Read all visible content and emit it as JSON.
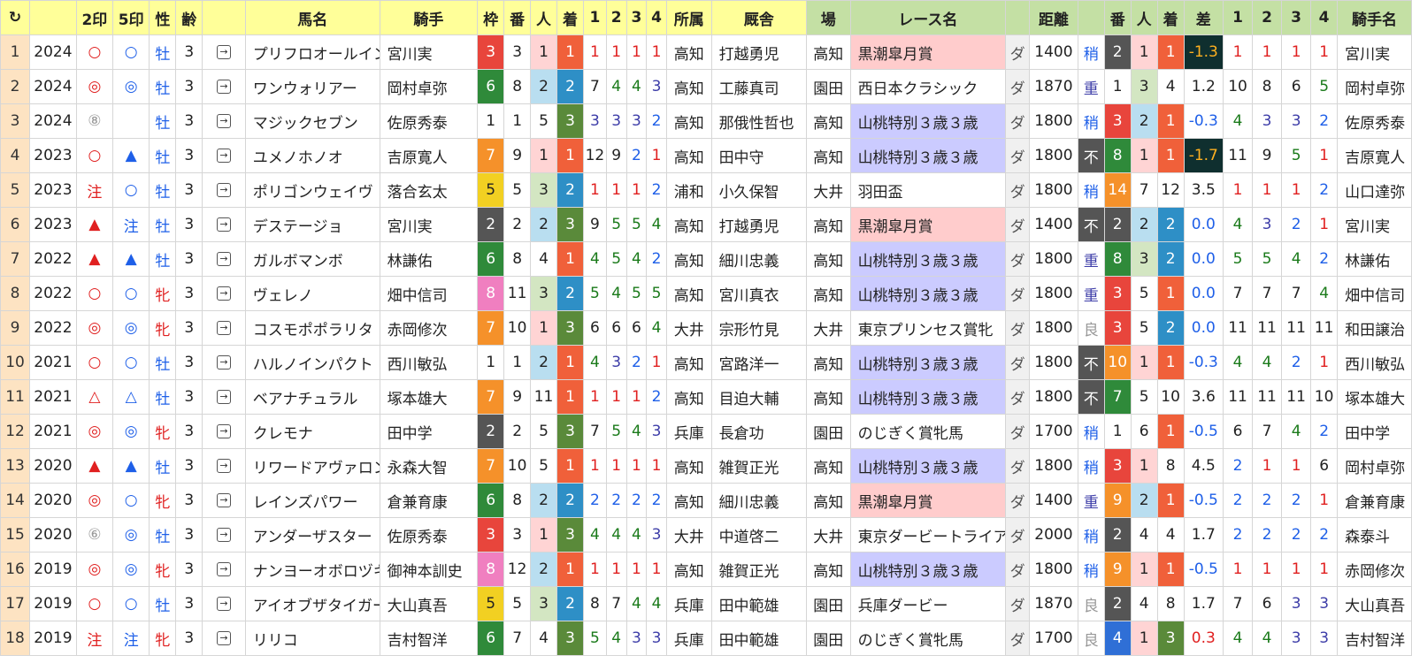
{
  "header": {
    "reload": "↻",
    "cols": [
      "",
      "2印",
      "5印",
      "性",
      "齢",
      "",
      "馬名",
      "騎手",
      "枠",
      "番",
      "人",
      "着",
      "1",
      "2",
      "3",
      "4",
      "所属",
      "厩舎",
      "場",
      "レース名",
      "",
      "距離",
      "",
      "番",
      "人",
      "着",
      "差",
      "1",
      "2",
      "3",
      "4",
      "騎手名"
    ]
  },
  "rows": [
    [
      "1",
      "2024",
      "○",
      "○",
      "牡",
      "3",
      "プリフロオールイン",
      "宮川実",
      "3",
      "3",
      "1",
      "1",
      "1",
      "1",
      "1",
      "1",
      "高知",
      "打越勇児",
      "高知",
      "黒潮皐月賞",
      "ダ",
      "1400",
      "稍",
      "2",
      "1",
      "1",
      "-1.3",
      "1",
      "1",
      "1",
      "1",
      "宮川実"
    ],
    [
      "2",
      "2024",
      "◎",
      "◎",
      "牡",
      "3",
      "ワンウォリアー",
      "岡村卓弥",
      "6",
      "8",
      "2",
      "2",
      "7",
      "4",
      "4",
      "3",
      "高知",
      "工藤真司",
      "園田",
      "西日本クラシック",
      "ダ",
      "1870",
      "重",
      "1",
      "3",
      "4",
      "1.2",
      "10",
      "8",
      "6",
      "5",
      "岡村卓弥"
    ],
    [
      "3",
      "2024",
      "⑧",
      "",
      "牡",
      "3",
      "マジックセブン",
      "佐原秀泰",
      "1",
      "1",
      "5",
      "3",
      "3",
      "3",
      "3",
      "2",
      "高知",
      "那俄性哲也",
      "高知",
      "山桃特別３歳３歳",
      "ダ",
      "1800",
      "稍",
      "3",
      "2",
      "1",
      "-0.3",
      "4",
      "3",
      "3",
      "2",
      "佐原秀泰"
    ],
    [
      "4",
      "2023",
      "○",
      "▲",
      "牡",
      "3",
      "ユメノホノオ",
      "吉原寛人",
      "7",
      "9",
      "1",
      "1",
      "12",
      "9",
      "2",
      "1",
      "高知",
      "田中守",
      "高知",
      "山桃特別３歳３歳",
      "ダ",
      "1800",
      "不",
      "8",
      "1",
      "1",
      "-1.7",
      "11",
      "9",
      "5",
      "1",
      "吉原寛人"
    ],
    [
      "5",
      "2023",
      "注",
      "○",
      "牡",
      "3",
      "ポリゴンウェイヴ",
      "落合玄太",
      "5",
      "5",
      "3",
      "2",
      "1",
      "1",
      "1",
      "2",
      "浦和",
      "小久保智",
      "大井",
      "羽田盃",
      "ダ",
      "1800",
      "稍",
      "14",
      "7",
      "12",
      "3.5",
      "1",
      "1",
      "1",
      "2",
      "山口達弥"
    ],
    [
      "6",
      "2023",
      "▲",
      "注",
      "牡",
      "3",
      "デステージョ",
      "宮川実",
      "2",
      "2",
      "2",
      "3",
      "9",
      "5",
      "5",
      "4",
      "高知",
      "打越勇児",
      "高知",
      "黒潮皐月賞",
      "ダ",
      "1400",
      "不",
      "2",
      "2",
      "2",
      "0.0",
      "4",
      "3",
      "2",
      "1",
      "宮川実"
    ],
    [
      "7",
      "2022",
      "▲",
      "▲",
      "牡",
      "3",
      "ガルボマンボ",
      "林謙佑",
      "6",
      "8",
      "4",
      "1",
      "4",
      "5",
      "4",
      "2",
      "高知",
      "細川忠義",
      "高知",
      "山桃特別３歳３歳",
      "ダ",
      "1800",
      "重",
      "8",
      "3",
      "2",
      "0.0",
      "5",
      "5",
      "4",
      "2",
      "林謙佑"
    ],
    [
      "8",
      "2022",
      "○",
      "○",
      "牝",
      "3",
      "ヴェレノ",
      "畑中信司",
      "8",
      "11",
      "3",
      "2",
      "5",
      "4",
      "5",
      "5",
      "高知",
      "宮川真衣",
      "高知",
      "山桃特別３歳３歳",
      "ダ",
      "1800",
      "重",
      "3",
      "5",
      "1",
      "0.0",
      "7",
      "7",
      "7",
      "4",
      "畑中信司"
    ],
    [
      "9",
      "2022",
      "◎",
      "◎",
      "牝",
      "3",
      "コスモポポラリタ",
      "赤岡修次",
      "7",
      "10",
      "1",
      "3",
      "6",
      "6",
      "6",
      "4",
      "大井",
      "宗形竹見",
      "大井",
      "東京プリンセス賞牝",
      "ダ",
      "1800",
      "良",
      "3",
      "5",
      "2",
      "0.0",
      "11",
      "11",
      "11",
      "11",
      "和田譲治"
    ],
    [
      "10",
      "2021",
      "○",
      "○",
      "牡",
      "3",
      "ハルノインパクト",
      "西川敏弘",
      "1",
      "1",
      "2",
      "1",
      "4",
      "3",
      "2",
      "1",
      "高知",
      "宮路洋一",
      "高知",
      "山桃特別３歳３歳",
      "ダ",
      "1800",
      "不",
      "10",
      "1",
      "1",
      "-0.3",
      "4",
      "4",
      "2",
      "1",
      "西川敏弘"
    ],
    [
      "11",
      "2021",
      "△",
      "△",
      "牡",
      "3",
      "ベアナチュラル",
      "塚本雄大",
      "7",
      "9",
      "11",
      "1",
      "1",
      "1",
      "1",
      "2",
      "高知",
      "目迫大輔",
      "高知",
      "山桃特別３歳３歳",
      "ダ",
      "1800",
      "不",
      "7",
      "5",
      "10",
      "3.6",
      "11",
      "11",
      "11",
      "10",
      "塚本雄大"
    ],
    [
      "12",
      "2021",
      "◎",
      "◎",
      "牝",
      "3",
      "クレモナ",
      "田中学",
      "2",
      "2",
      "5",
      "3",
      "7",
      "5",
      "4",
      "3",
      "兵庫",
      "長倉功",
      "園田",
      "のじぎく賞牝馬",
      "ダ",
      "1700",
      "稍",
      "1",
      "6",
      "1",
      "-0.5",
      "6",
      "7",
      "4",
      "2",
      "田中学"
    ],
    [
      "13",
      "2020",
      "▲",
      "▲",
      "牡",
      "3",
      "リワードアヴァロン",
      "永森大智",
      "7",
      "10",
      "5",
      "1",
      "1",
      "1",
      "1",
      "1",
      "高知",
      "雑賀正光",
      "高知",
      "山桃特別３歳３歳",
      "ダ",
      "1800",
      "稍",
      "3",
      "1",
      "8",
      "4.5",
      "2",
      "1",
      "1",
      "6",
      "岡村卓弥"
    ],
    [
      "14",
      "2020",
      "◎",
      "○",
      "牝",
      "3",
      "レインズパワー",
      "倉兼育康",
      "6",
      "8",
      "2",
      "2",
      "2",
      "2",
      "2",
      "2",
      "高知",
      "細川忠義",
      "高知",
      "黒潮皐月賞",
      "ダ",
      "1400",
      "重",
      "9",
      "2",
      "1",
      "-0.5",
      "2",
      "2",
      "2",
      "1",
      "倉兼育康"
    ],
    [
      "15",
      "2020",
      "⑥",
      "◎",
      "牡",
      "3",
      "アンダーザスター",
      "佐原秀泰",
      "3",
      "3",
      "1",
      "3",
      "4",
      "4",
      "4",
      "3",
      "大井",
      "中道啓二",
      "大井",
      "東京ダービートライア",
      "ダ",
      "2000",
      "稍",
      "2",
      "4",
      "4",
      "1.7",
      "2",
      "2",
      "2",
      "2",
      "森泰斗"
    ],
    [
      "16",
      "2019",
      "◎",
      "◎",
      "牝",
      "3",
      "ナンヨーオボロヅキ",
      "御神本訓史",
      "8",
      "12",
      "2",
      "1",
      "1",
      "1",
      "1",
      "1",
      "高知",
      "雑賀正光",
      "高知",
      "山桃特別３歳３歳",
      "ダ",
      "1800",
      "稍",
      "9",
      "1",
      "1",
      "-0.5",
      "1",
      "1",
      "1",
      "1",
      "赤岡修次"
    ],
    [
      "17",
      "2019",
      "○",
      "○",
      "牡",
      "3",
      "アイオブザタイガー",
      "大山真吾",
      "5",
      "5",
      "3",
      "2",
      "8",
      "7",
      "4",
      "4",
      "兵庫",
      "田中範雄",
      "園田",
      "兵庫ダービー",
      "ダ",
      "1870",
      "良",
      "2",
      "4",
      "8",
      "1.7",
      "7",
      "6",
      "3",
      "3",
      "大山真吾"
    ],
    [
      "18",
      "2019",
      "注",
      "注",
      "牝",
      "3",
      "リリコ",
      "吉村智洋",
      "6",
      "7",
      "4",
      "3",
      "5",
      "4",
      "3",
      "3",
      "兵庫",
      "田中範雄",
      "園田",
      "のじぎく賞牝馬",
      "ダ",
      "1700",
      "良",
      "4",
      "1",
      "3",
      "0.3",
      "4",
      "4",
      "3",
      "3",
      "吉村智洋"
    ]
  ],
  "colors": {
    "frame": {
      "1": "#ffffff",
      "2": "#555555",
      "3": "#e8453c",
      "4": "#2f6fd6",
      "5": "#f2d022",
      "6": "#2f8a3a",
      "7": "#f5912a",
      "8": "#f07fc0"
    },
    "finish": {
      "1": "#f0603a",
      "2": "#2e8fc6",
      "3": "#5a8a3a"
    },
    "dark_badge": "#555555"
  }
}
